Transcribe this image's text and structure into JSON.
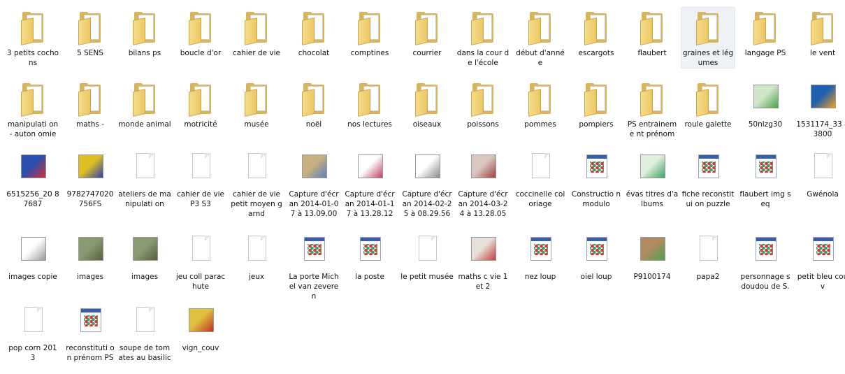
{
  "items": [
    {
      "label": "3 petits cochons",
      "kind": "folder"
    },
    {
      "label": "5 SENS",
      "kind": "folder"
    },
    {
      "label": "bilans ps",
      "kind": "folder"
    },
    {
      "label": "boucle d'or",
      "kind": "folder"
    },
    {
      "label": "cahier de vie",
      "kind": "folder"
    },
    {
      "label": "chocolat",
      "kind": "folder"
    },
    {
      "label": "comptines",
      "kind": "folder"
    },
    {
      "label": "courrier",
      "kind": "folder"
    },
    {
      "label": "dans la cour de l'école",
      "kind": "folder"
    },
    {
      "label": "début d'année",
      "kind": "folder"
    },
    {
      "label": "escargots",
      "kind": "folder"
    },
    {
      "label": "flaubert",
      "kind": "folder"
    },
    {
      "label": "graines et légumes",
      "kind": "folder",
      "selected": true
    },
    {
      "label": "langage PS",
      "kind": "folder"
    },
    {
      "label": "le vent",
      "kind": "folder"
    },
    {
      "label": "manipulati on - auton omie",
      "kind": "folder"
    },
    {
      "label": "maths -",
      "kind": "folder"
    },
    {
      "label": "monde animal",
      "kind": "folder"
    },
    {
      "label": "motricité",
      "kind": "folder"
    },
    {
      "label": "musée",
      "kind": "folder"
    },
    {
      "label": "noël",
      "kind": "folder"
    },
    {
      "label": "nos lectures",
      "kind": "folder"
    },
    {
      "label": "oiseaux",
      "kind": "folder"
    },
    {
      "label": "poissons",
      "kind": "folder"
    },
    {
      "label": "pommes",
      "kind": "folder"
    },
    {
      "label": "pompiers",
      "kind": "folder"
    },
    {
      "label": "PS entraineme nt prénom",
      "kind": "folder"
    },
    {
      "label": "roule galette",
      "kind": "folder"
    },
    {
      "label": "50nlzg30",
      "kind": "image"
    },
    {
      "label": "1531174_33 83800",
      "kind": "image"
    },
    {
      "label": "6515256_20 87687",
      "kind": "image"
    },
    {
      "label": "9782747020 756FS",
      "kind": "image"
    },
    {
      "label": "ateliers de manipulati on",
      "kind": "doc"
    },
    {
      "label": "cahier de vie P3 S3",
      "kind": "doc"
    },
    {
      "label": "cahier de vie petit moyen garnd",
      "kind": "doc"
    },
    {
      "label": "Capture d'écran 2014-01-07 à 13.09.00",
      "kind": "image"
    },
    {
      "label": "Capture d'écran 2014-01-17 à 13.28.12",
      "kind": "image"
    },
    {
      "label": "Capture d'écran 2014-02-25 à 08.29.56",
      "kind": "image"
    },
    {
      "label": "Capture d'écran 2014-03-24 à 13.28.05",
      "kind": "image"
    },
    {
      "label": "coccinelle coloriage",
      "kind": "doc"
    },
    {
      "label": "Constructio n modulo",
      "kind": "app"
    },
    {
      "label": "évas titres d'albums",
      "kind": "image"
    },
    {
      "label": "fiche reconstitui on puzzle",
      "kind": "app"
    },
    {
      "label": "flaubert img seq",
      "kind": "app"
    },
    {
      "label": "Gwénola",
      "kind": "doc"
    },
    {
      "label": "images copie",
      "kind": "image"
    },
    {
      "label": "images",
      "kind": "image"
    },
    {
      "label": "images",
      "kind": "image"
    },
    {
      "label": "jeu coll parachute",
      "kind": "doc"
    },
    {
      "label": "jeux",
      "kind": "doc"
    },
    {
      "label": "La porte Michel van zeveren",
      "kind": "app"
    },
    {
      "label": "la poste",
      "kind": "app"
    },
    {
      "label": "le petit musée",
      "kind": "doc"
    },
    {
      "label": "maths c vie 1 et 2",
      "kind": "image"
    },
    {
      "label": "nez loup",
      "kind": "app"
    },
    {
      "label": "oiel loup",
      "kind": "app"
    },
    {
      "label": "P9100174",
      "kind": "image"
    },
    {
      "label": "papa2",
      "kind": "doc"
    },
    {
      "label": "personnage s doudou de S.",
      "kind": "app"
    },
    {
      "label": "petit bleu couv",
      "kind": "app"
    },
    {
      "label": "pop corn 2013",
      "kind": "doc"
    },
    {
      "label": "reconstituti on prénom PS",
      "kind": "app"
    },
    {
      "label": "soupe de tomates au basilic",
      "kind": "doc"
    },
    {
      "label": "vign_couv",
      "kind": "image"
    }
  ],
  "colors": {
    "selection": "#eef1f6",
    "folder": "#ecc764"
  }
}
